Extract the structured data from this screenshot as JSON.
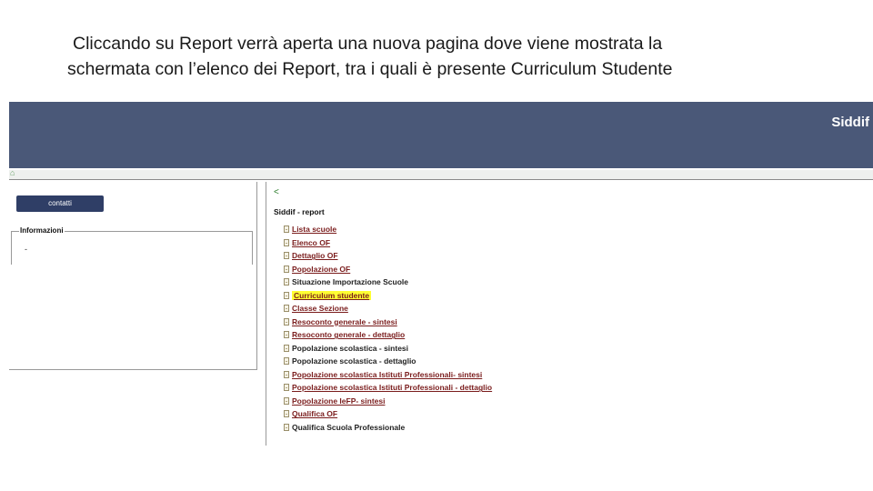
{
  "caption": {
    "line1": "Cliccando su Report verrà aperta una nuova pagina dove viene mostrata la",
    "line2": "schermata con l’elenco dei Report, tra i quali è presente Curriculum Studente"
  },
  "banner": {
    "title": "Siddif"
  },
  "subbar": {
    "icon": "home-icon"
  },
  "left": {
    "contatti_label": "contatti",
    "info_legend": "Informazioni",
    "info_value": "-"
  },
  "right": {
    "back": "<",
    "title": "Siddif - report",
    "reports": [
      {
        "label": "Lista scuole",
        "link": true
      },
      {
        "label": "Elenco OF",
        "link": true
      },
      {
        "label": "Dettaglio OF",
        "link": true
      },
      {
        "label": "Popolazione OF",
        "link": true
      },
      {
        "label": "Situazione Importazione Scuole",
        "link": false
      },
      {
        "label": "Curriculum studente",
        "link": true,
        "highlighted": true
      },
      {
        "label": "Classe Sezione",
        "link": true
      },
      {
        "label": "Resoconto generale - sintesi",
        "link": true
      },
      {
        "label": "Resoconto generale - dettaglio",
        "link": true
      },
      {
        "label": "Popolazione scolastica - sintesi",
        "link": false
      },
      {
        "label": "Popolazione scolastica - dettaglio",
        "link": false
      },
      {
        "label": "Popolazione scolastica Istituti Professionali- sintesi",
        "link": true
      },
      {
        "label": "Popolazione scolastica Istituti Professionali - dettaglio",
        "link": true
      },
      {
        "label": "Popolazione IeFP- sintesi",
        "link": true
      },
      {
        "label": "Qualifica OF",
        "link": true
      },
      {
        "label": "Qualifica Scuola Professionale",
        "link": false
      }
    ],
    "highlight_color": "#ffff33",
    "link_color": "#7a1c1c"
  },
  "colors": {
    "banner": "#4a5878",
    "button": "#2f3e66"
  }
}
